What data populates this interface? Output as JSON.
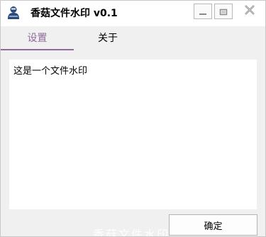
{
  "window": {
    "title": "香菇文件水印 v0.1",
    "app_icon": "user-avatar-icon",
    "controls": {
      "minimize_icon": "minimize-icon",
      "maximize_icon": "maximize-icon",
      "close_icon": "close-icon"
    }
  },
  "tabs": [
    {
      "label": "设置",
      "active": true
    },
    {
      "label": "关于",
      "active": false
    }
  ],
  "content": {
    "text": "这是一个文件水印"
  },
  "footer": {
    "ok_label": "确定"
  },
  "watermark": {
    "text": "香菇文件水印"
  },
  "colors": {
    "accent": "#8f6b9c",
    "background": "#f0f0f0",
    "content_bg": "#ffffff"
  }
}
